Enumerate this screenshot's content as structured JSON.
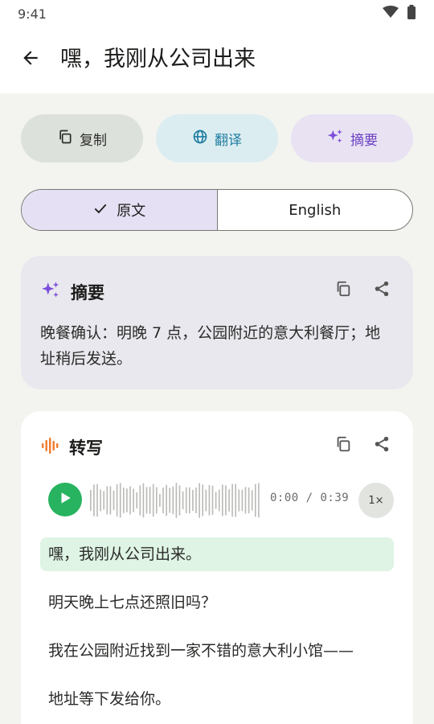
{
  "status_bar": {
    "time": "9:41"
  },
  "app_bar": {
    "title": "嘿，我刚从公司出来"
  },
  "actions": {
    "copy_label": "复制",
    "translate_label": "翻译",
    "summary_label": "摘要"
  },
  "segment": {
    "original_label": "原文",
    "english_label": "English",
    "selected": "原文"
  },
  "summary_card": {
    "title": "摘要",
    "text": "晚餐确认：明晚 7 点，公园附近的意大利餐厅；地址稍后发送。"
  },
  "transcript_card": {
    "title": "转写",
    "player": {
      "time_readout": "0:00 / 0:39",
      "speed": "1×"
    },
    "lines": [
      "嘿，我刚从公司出来。",
      "明天晚上七点还照旧吗？",
      "我在公园附近找到一家不错的意大利小馆——",
      "地址等下发给你。"
    ],
    "highlighted_line": 0
  },
  "colors": {
    "accent_green": "#27b35f",
    "accent_purple": "#7c4ddb",
    "accent_blue": "#1f7da0",
    "accent_orange": "#f07a2a"
  },
  "icons": {
    "back": "arrow-left-icon",
    "copy": "copy-icon",
    "translate": "globe-icon",
    "summary": "sparkles-icon",
    "share": "share-icon",
    "transcript": "waveform-icon",
    "check": "check-icon",
    "play": "play-icon",
    "wifi": "wifi-icon",
    "battery": "battery-icon"
  }
}
